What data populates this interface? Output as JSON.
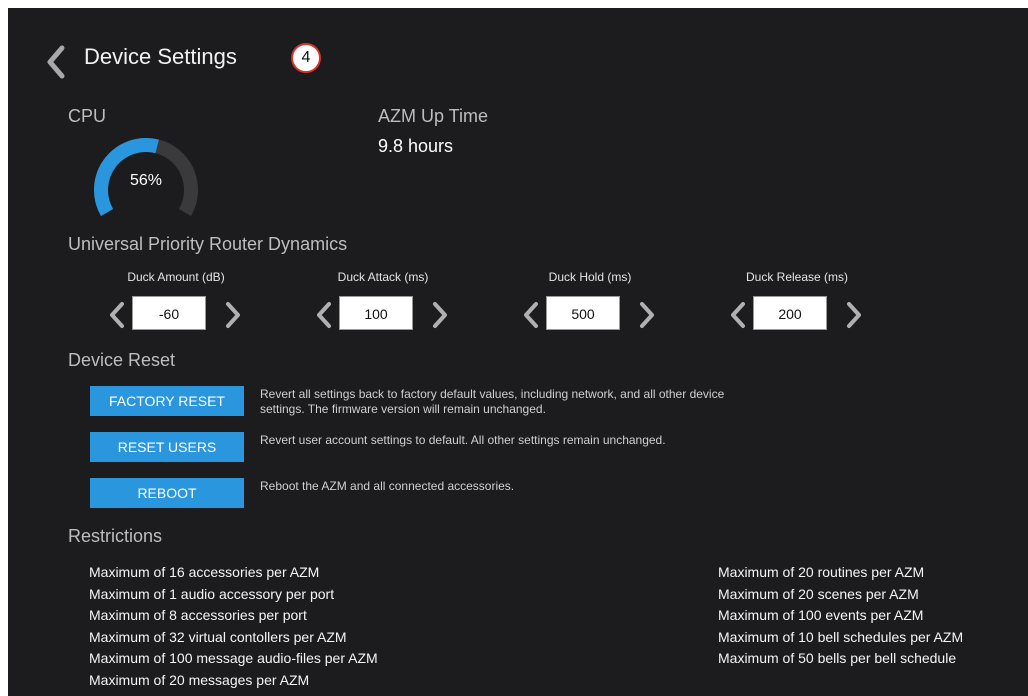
{
  "header": {
    "title": "Device Settings",
    "step_badge": "4"
  },
  "cpu": {
    "label": "CPU",
    "value_text": "56%",
    "percent": 56
  },
  "uptime": {
    "label": "AZM Up Time",
    "value": "9.8 hours"
  },
  "upr": {
    "title": "Universal Priority Router Dynamics",
    "controls": [
      {
        "label": "Duck Amount (dB)",
        "value": "-60"
      },
      {
        "label": "Duck Attack (ms)",
        "value": "100"
      },
      {
        "label": "Duck Hold (ms)",
        "value": "500"
      },
      {
        "label": "Duck Release (ms)",
        "value": "200"
      }
    ]
  },
  "reset": {
    "title": "Device Reset",
    "actions": [
      {
        "label": "FACTORY RESET",
        "description_line1": "Revert all settings back to factory default values, including network, and all other device",
        "description_line2": "settings. The firmware version will remain unchanged."
      },
      {
        "label": "RESET USERS",
        "description_line1": "Revert user account settings to default. All other settings remain unchanged.",
        "description_line2": ""
      },
      {
        "label": "REBOOT",
        "description_line1": "Reboot the AZM and all connected accessories.",
        "description_line2": ""
      }
    ]
  },
  "restrictions": {
    "title": "Restrictions",
    "left": [
      "Maximum of 16 accessories per AZM",
      "Maximum of 1 audio accessory per port",
      "Maximum of 8 accessories per port",
      "Maximum of 32 virtual contollers per AZM",
      "Maximum of 100 message audio-files per AZM",
      "Maximum of 20 messages per AZM"
    ],
    "right": [
      "Maximum of 20 routines per AZM",
      "Maximum of 20 scenes per AZM",
      "Maximum of 100 events per AZM",
      "Maximum of 10 bell schedules per AZM",
      "Maximum of 50 bells per bell schedule"
    ]
  },
  "colors": {
    "background": "#1c1c1e",
    "accent": "#2996dd",
    "gauge_track": "#3a3a3c",
    "badge_border": "#d9342b"
  }
}
